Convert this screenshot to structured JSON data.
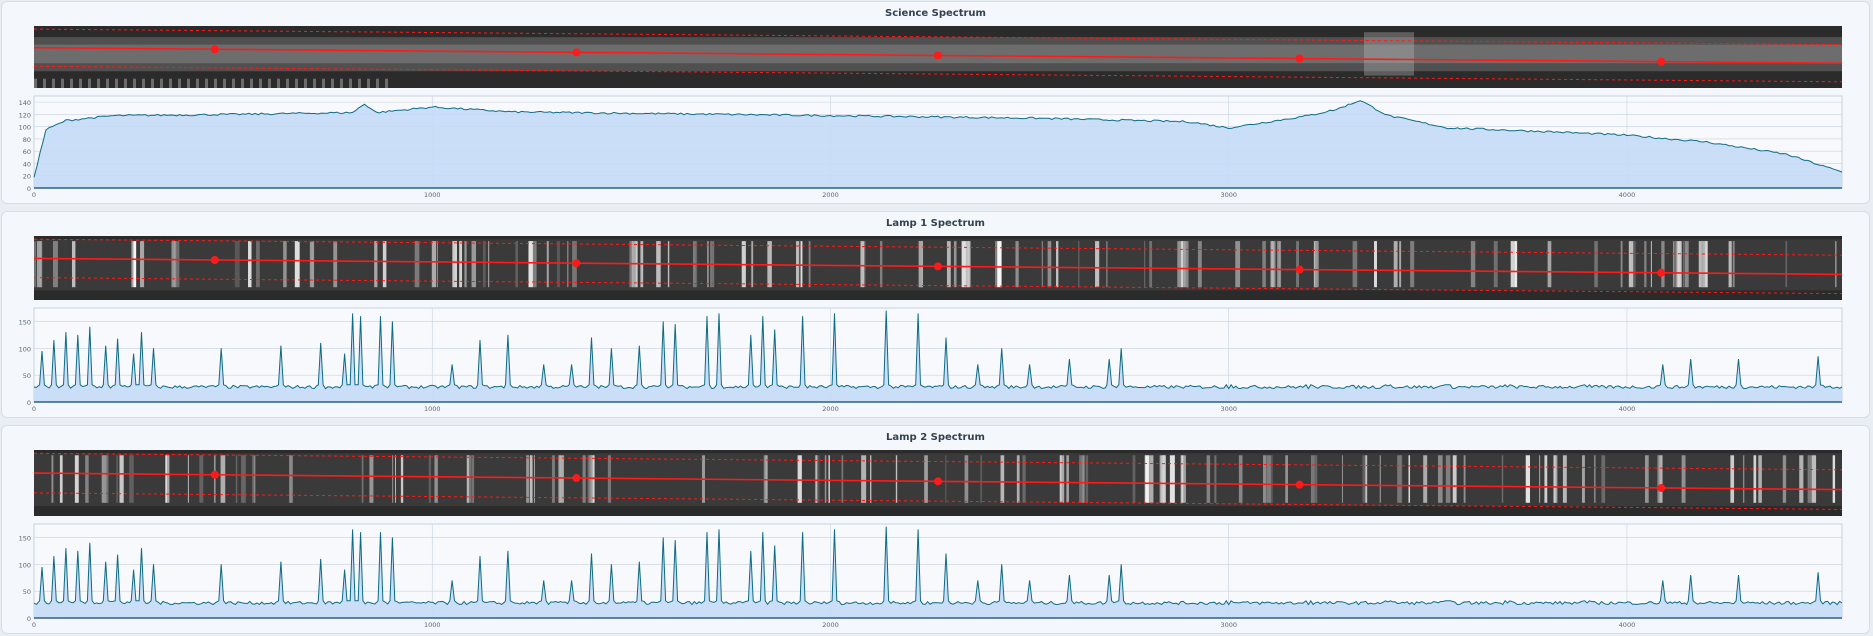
{
  "panels": [
    {
      "id": "science",
      "title": "Science Spectrum",
      "kind": "science",
      "trace_points": 5,
      "chart_data": {
        "type": "area",
        "title": "Science Spectrum",
        "xlim": [
          0,
          4540
        ],
        "ylim": [
          0,
          150
        ],
        "xticks": [
          0,
          1000,
          2000,
          3000,
          4000
        ],
        "yticks": [
          0,
          20,
          40,
          60,
          80,
          100,
          120,
          140
        ],
        "grid": true,
        "series": [
          {
            "x": [
              0,
              30,
              80,
              200,
              500,
              800,
              830,
              860,
              1000,
              1200,
              2000,
              2500,
              2900,
              3000,
              3100,
              3200,
              3270,
              3330,
              3400,
              3550,
              3800,
              4000,
              4200,
              4400,
              4540
            ],
            "y": [
              18,
              95,
              110,
              118,
              120,
              123,
              137,
              123,
              132,
              124,
              118,
              114,
              108,
              98,
              108,
              118,
              128,
              143,
              118,
              98,
              92,
              86,
              75,
              55,
              26
            ]
          }
        ]
      }
    },
    {
      "id": "lamp1",
      "title": "Lamp 1 Spectrum",
      "kind": "lamp",
      "trace_points": 5,
      "chart_data": {
        "type": "line",
        "title": "Lamp 1 Spectrum",
        "xlim": [
          0,
          4540
        ],
        "ylim": [
          0,
          175
        ],
        "xticks": [
          0,
          1000,
          2000,
          3000,
          4000
        ],
        "yticks": [
          0,
          50,
          100,
          150
        ],
        "grid": true,
        "series": [
          {
            "x": [
              20,
              50,
              80,
              110,
              140,
              180,
              210,
              250,
              270,
              300,
              470,
              620,
              720,
              780,
              800,
              820,
              870,
              900,
              1050,
              1120,
              1190,
              1280,
              1350,
              1400,
              1450,
              1520,
              1580,
              1610,
              1690,
              1720,
              1800,
              1830,
              1860,
              1930,
              2010,
              2140,
              2220,
              2290,
              2370,
              2430,
              2500,
              2600,
              2700,
              2730,
              3000,
              3200,
              3400,
              3550,
              3700,
              3900,
              4090,
              4160,
              4280,
              4480
            ],
            "y": [
              95,
              115,
              130,
              125,
              140,
              105,
              118,
              90,
              130,
              100,
              100,
              105,
              110,
              90,
              165,
              160,
              160,
              150,
              70,
              115,
              125,
              70,
              70,
              120,
              100,
              105,
              150,
              145,
              160,
              165,
              125,
              160,
              135,
              160,
              165,
              170,
              165,
              120,
              70,
              100,
              70,
              80,
              80,
              100,
              25,
              25,
              30,
              32,
              28,
              28,
              70,
              80,
              80,
              85
            ]
          }
        ]
      }
    },
    {
      "id": "lamp2",
      "title": "Lamp 2 Spectrum",
      "kind": "lamp",
      "trace_points": 5,
      "chart_data": {
        "type": "line",
        "title": "Lamp 2 Spectrum",
        "xlim": [
          0,
          4540
        ],
        "ylim": [
          0,
          175
        ],
        "xticks": [
          0,
          1000,
          2000,
          3000,
          4000
        ],
        "yticks": [
          0,
          50,
          100,
          150
        ],
        "grid": true,
        "series": [
          {
            "x": [
              20,
              50,
              80,
              110,
              140,
              180,
              210,
              250,
              270,
              300,
              470,
              620,
              720,
              780,
              800,
              820,
              870,
              900,
              1050,
              1120,
              1190,
              1280,
              1350,
              1400,
              1450,
              1520,
              1580,
              1610,
              1690,
              1720,
              1800,
              1830,
              1860,
              1930,
              2010,
              2140,
              2220,
              2290,
              2370,
              2430,
              2500,
              2600,
              2700,
              2730,
              3000,
              3200,
              3400,
              3550,
              3700,
              3900,
              4090,
              4160,
              4280,
              4480
            ],
            "y": [
              95,
              115,
              130,
              125,
              140,
              105,
              118,
              90,
              130,
              100,
              100,
              105,
              110,
              90,
              165,
              160,
              160,
              150,
              70,
              115,
              125,
              70,
              70,
              120,
              100,
              105,
              150,
              145,
              160,
              165,
              125,
              160,
              135,
              160,
              165,
              170,
              165,
              120,
              70,
              100,
              70,
              80,
              80,
              100,
              25,
              25,
              30,
              32,
              28,
              28,
              70,
              80,
              80,
              85
            ]
          }
        ]
      }
    }
  ],
  "colors": {
    "trace": "#ff1a1a",
    "line": "#0e6b86",
    "fill": "#c4dcf6",
    "grid": "#c9d2de"
  }
}
